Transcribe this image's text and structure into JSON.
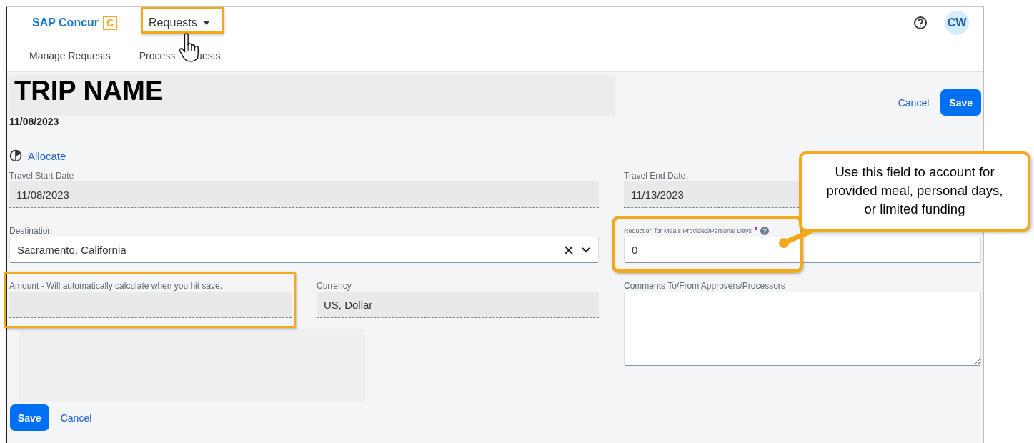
{
  "header": {
    "brand": "SAP Concur",
    "brand_mark": "C",
    "menu": {
      "label": "Requests",
      "expanded": false
    },
    "avatar": "CW"
  },
  "nav": [
    {
      "label": "Manage Requests",
      "selected": false
    },
    {
      "label": "Process",
      "label_after_cursor": "uests",
      "selected": false
    }
  ],
  "request": {
    "title": "TRIP NAME",
    "date": "11/08/2023",
    "cancel": "Cancel",
    "save": "Save"
  },
  "allocate": "Allocate",
  "travel_start": {
    "label": "Travel Start Date",
    "value": "11/08/2023"
  },
  "travel_end": {
    "label": "Travel End Date",
    "value": "11/13/2023"
  },
  "destination": {
    "label": "Destination",
    "value": "Sacramento, California"
  },
  "reduction": {
    "label": "Reduction for Meals Provided/Personal Days",
    "required": true,
    "value": "0"
  },
  "amount": {
    "label": "Amount - Will automatically calculate when you hit save."
  },
  "currency": {
    "label": "Currency",
    "value": "US, Dollar"
  },
  "comments": {
    "label": "Comments To/From Approvers/Processors"
  },
  "bottom_actions": {
    "save": "Save",
    "cancel": "Cancel"
  },
  "callout": "Use this field to account for provided meal, personal days, or limited funding"
}
